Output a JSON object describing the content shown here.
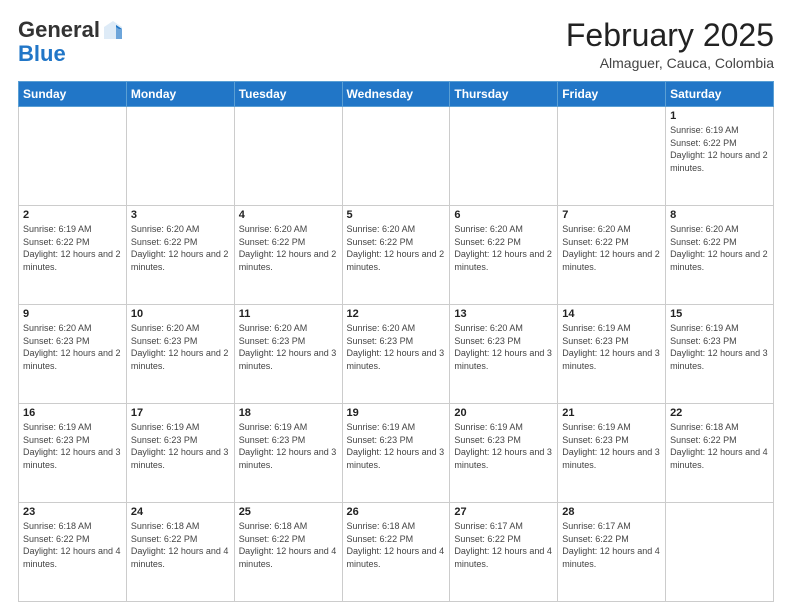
{
  "logo": {
    "general": "General",
    "blue": "Blue"
  },
  "header": {
    "title": "February 2025",
    "subtitle": "Almaguer, Cauca, Colombia"
  },
  "days_of_week": [
    "Sunday",
    "Monday",
    "Tuesday",
    "Wednesday",
    "Thursday",
    "Friday",
    "Saturday"
  ],
  "weeks": [
    [
      {
        "day": "",
        "info": ""
      },
      {
        "day": "",
        "info": ""
      },
      {
        "day": "",
        "info": ""
      },
      {
        "day": "",
        "info": ""
      },
      {
        "day": "",
        "info": ""
      },
      {
        "day": "",
        "info": ""
      },
      {
        "day": "1",
        "info": "Sunrise: 6:19 AM\nSunset: 6:22 PM\nDaylight: 12 hours and 2 minutes."
      }
    ],
    [
      {
        "day": "2",
        "info": "Sunrise: 6:19 AM\nSunset: 6:22 PM\nDaylight: 12 hours and 2 minutes."
      },
      {
        "day": "3",
        "info": "Sunrise: 6:20 AM\nSunset: 6:22 PM\nDaylight: 12 hours and 2 minutes."
      },
      {
        "day": "4",
        "info": "Sunrise: 6:20 AM\nSunset: 6:22 PM\nDaylight: 12 hours and 2 minutes."
      },
      {
        "day": "5",
        "info": "Sunrise: 6:20 AM\nSunset: 6:22 PM\nDaylight: 12 hours and 2 minutes."
      },
      {
        "day": "6",
        "info": "Sunrise: 6:20 AM\nSunset: 6:22 PM\nDaylight: 12 hours and 2 minutes."
      },
      {
        "day": "7",
        "info": "Sunrise: 6:20 AM\nSunset: 6:22 PM\nDaylight: 12 hours and 2 minutes."
      },
      {
        "day": "8",
        "info": "Sunrise: 6:20 AM\nSunset: 6:22 PM\nDaylight: 12 hours and 2 minutes."
      }
    ],
    [
      {
        "day": "9",
        "info": "Sunrise: 6:20 AM\nSunset: 6:23 PM\nDaylight: 12 hours and 2 minutes."
      },
      {
        "day": "10",
        "info": "Sunrise: 6:20 AM\nSunset: 6:23 PM\nDaylight: 12 hours and 2 minutes."
      },
      {
        "day": "11",
        "info": "Sunrise: 6:20 AM\nSunset: 6:23 PM\nDaylight: 12 hours and 3 minutes."
      },
      {
        "day": "12",
        "info": "Sunrise: 6:20 AM\nSunset: 6:23 PM\nDaylight: 12 hours and 3 minutes."
      },
      {
        "day": "13",
        "info": "Sunrise: 6:20 AM\nSunset: 6:23 PM\nDaylight: 12 hours and 3 minutes."
      },
      {
        "day": "14",
        "info": "Sunrise: 6:19 AM\nSunset: 6:23 PM\nDaylight: 12 hours and 3 minutes."
      },
      {
        "day": "15",
        "info": "Sunrise: 6:19 AM\nSunset: 6:23 PM\nDaylight: 12 hours and 3 minutes."
      }
    ],
    [
      {
        "day": "16",
        "info": "Sunrise: 6:19 AM\nSunset: 6:23 PM\nDaylight: 12 hours and 3 minutes."
      },
      {
        "day": "17",
        "info": "Sunrise: 6:19 AM\nSunset: 6:23 PM\nDaylight: 12 hours and 3 minutes."
      },
      {
        "day": "18",
        "info": "Sunrise: 6:19 AM\nSunset: 6:23 PM\nDaylight: 12 hours and 3 minutes."
      },
      {
        "day": "19",
        "info": "Sunrise: 6:19 AM\nSunset: 6:23 PM\nDaylight: 12 hours and 3 minutes."
      },
      {
        "day": "20",
        "info": "Sunrise: 6:19 AM\nSunset: 6:23 PM\nDaylight: 12 hours and 3 minutes."
      },
      {
        "day": "21",
        "info": "Sunrise: 6:19 AM\nSunset: 6:23 PM\nDaylight: 12 hours and 3 minutes."
      },
      {
        "day": "22",
        "info": "Sunrise: 6:18 AM\nSunset: 6:22 PM\nDaylight: 12 hours and 4 minutes."
      }
    ],
    [
      {
        "day": "23",
        "info": "Sunrise: 6:18 AM\nSunset: 6:22 PM\nDaylight: 12 hours and 4 minutes."
      },
      {
        "day": "24",
        "info": "Sunrise: 6:18 AM\nSunset: 6:22 PM\nDaylight: 12 hours and 4 minutes."
      },
      {
        "day": "25",
        "info": "Sunrise: 6:18 AM\nSunset: 6:22 PM\nDaylight: 12 hours and 4 minutes."
      },
      {
        "day": "26",
        "info": "Sunrise: 6:18 AM\nSunset: 6:22 PM\nDaylight: 12 hours and 4 minutes."
      },
      {
        "day": "27",
        "info": "Sunrise: 6:17 AM\nSunset: 6:22 PM\nDaylight: 12 hours and 4 minutes."
      },
      {
        "day": "28",
        "info": "Sunrise: 6:17 AM\nSunset: 6:22 PM\nDaylight: 12 hours and 4 minutes."
      },
      {
        "day": "",
        "info": ""
      }
    ]
  ]
}
